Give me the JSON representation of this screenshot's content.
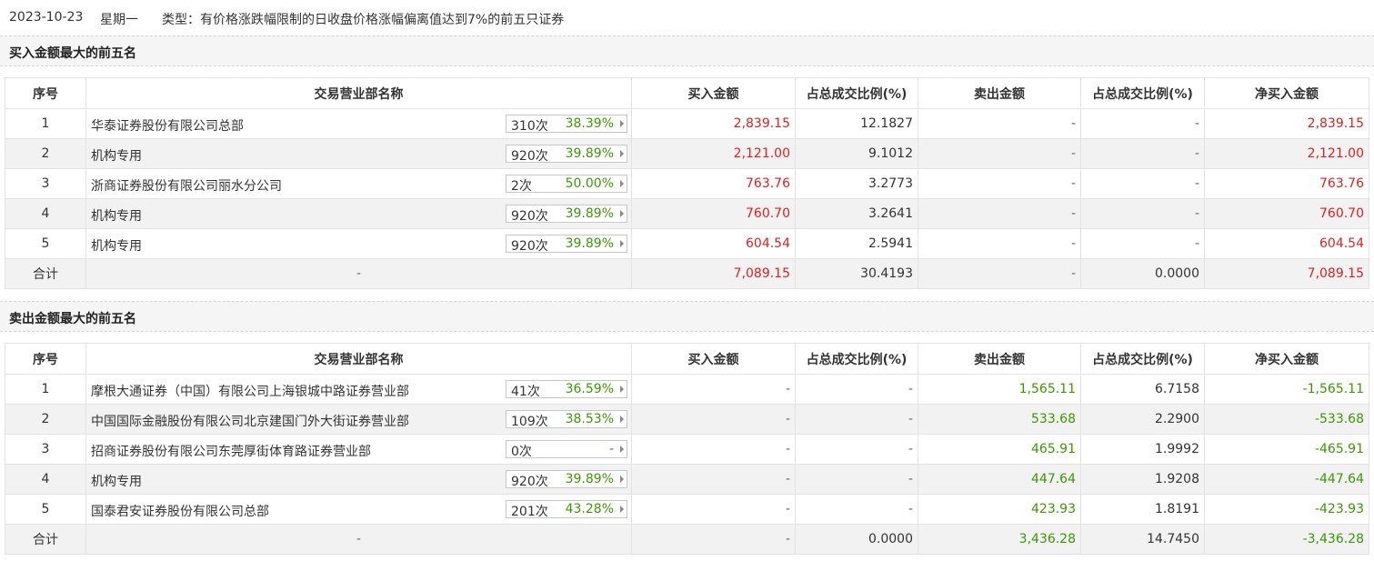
{
  "header": {
    "date": "2023-10-23",
    "weekday": "星期一",
    "type_label": "类型：有价格涨跌幅限制的日收盘价格涨幅偏离值达到7%的前五只证券"
  },
  "columns": [
    "序号",
    "交易营业部名称",
    "买入金额",
    "占总成交比例(%)",
    "卖出金额",
    "占总成交比例(%)",
    "净买入金额"
  ],
  "buy_section": {
    "title": "买入金额最大的前五名",
    "rows": [
      {
        "idx": "1",
        "name": "华泰证券股份有限公司总部",
        "times": "310次",
        "rate": "38.39%",
        "buy": "2,839.15",
        "buy_pct": "12.1827",
        "sell": "-",
        "sell_pct": "-",
        "net": "2,839.15"
      },
      {
        "idx": "2",
        "name": "机构专用",
        "times": "920次",
        "rate": "39.89%",
        "buy": "2,121.00",
        "buy_pct": "9.1012",
        "sell": "-",
        "sell_pct": "-",
        "net": "2,121.00"
      },
      {
        "idx": "3",
        "name": "浙商证券股份有限公司丽水分公司",
        "times": "2次",
        "rate": "50.00%",
        "buy": "763.76",
        "buy_pct": "3.2773",
        "sell": "-",
        "sell_pct": "-",
        "net": "763.76"
      },
      {
        "idx": "4",
        "name": "机构专用",
        "times": "920次",
        "rate": "39.89%",
        "buy": "760.70",
        "buy_pct": "3.2641",
        "sell": "-",
        "sell_pct": "-",
        "net": "760.70"
      },
      {
        "idx": "5",
        "name": "机构专用",
        "times": "920次",
        "rate": "39.89%",
        "buy": "604.54",
        "buy_pct": "2.5941",
        "sell": "-",
        "sell_pct": "-",
        "net": "604.54"
      }
    ],
    "total": {
      "label": "合计",
      "name": "-",
      "buy": "7,089.15",
      "buy_pct": "30.4193",
      "sell": "-",
      "sell_pct": "0.0000",
      "net": "7,089.15"
    }
  },
  "sell_section": {
    "title": "卖出金额最大的前五名",
    "rows": [
      {
        "idx": "1",
        "name": "摩根大通证券（中国）有限公司上海银城中路证券营业部",
        "times": "41次",
        "rate": "36.59%",
        "buy": "-",
        "buy_pct": "-",
        "sell": "1,565.11",
        "sell_pct": "6.7158",
        "net": "-1,565.11"
      },
      {
        "idx": "2",
        "name": "中国国际金融股份有限公司北京建国门外大街证券营业部",
        "times": "109次",
        "rate": "38.53%",
        "buy": "-",
        "buy_pct": "-",
        "sell": "533.68",
        "sell_pct": "2.2900",
        "net": "-533.68"
      },
      {
        "idx": "3",
        "name": "招商证券股份有限公司东莞厚街体育路证券营业部",
        "times": "0次",
        "rate": "-",
        "buy": "-",
        "buy_pct": "-",
        "sell": "465.91",
        "sell_pct": "1.9992",
        "net": "-465.91"
      },
      {
        "idx": "4",
        "name": "机构专用",
        "times": "920次",
        "rate": "39.89%",
        "buy": "-",
        "buy_pct": "-",
        "sell": "447.64",
        "sell_pct": "1.9208",
        "net": "-447.64"
      },
      {
        "idx": "5",
        "name": "国泰君安证券股份有限公司总部",
        "times": "201次",
        "rate": "43.28%",
        "buy": "-",
        "buy_pct": "-",
        "sell": "423.93",
        "sell_pct": "1.8191",
        "net": "-423.93"
      }
    ],
    "total": {
      "label": "合计",
      "name": "-",
      "buy": "-",
      "buy_pct": "0.0000",
      "sell": "3,436.28",
      "sell_pct": "14.7450",
      "net": "-3,436.28"
    }
  },
  "colors": {
    "buy": "#e02020",
    "sell": "#3a9a00",
    "header_bg": "#f5f5f5",
    "alt_row": "#f2f2f2"
  }
}
